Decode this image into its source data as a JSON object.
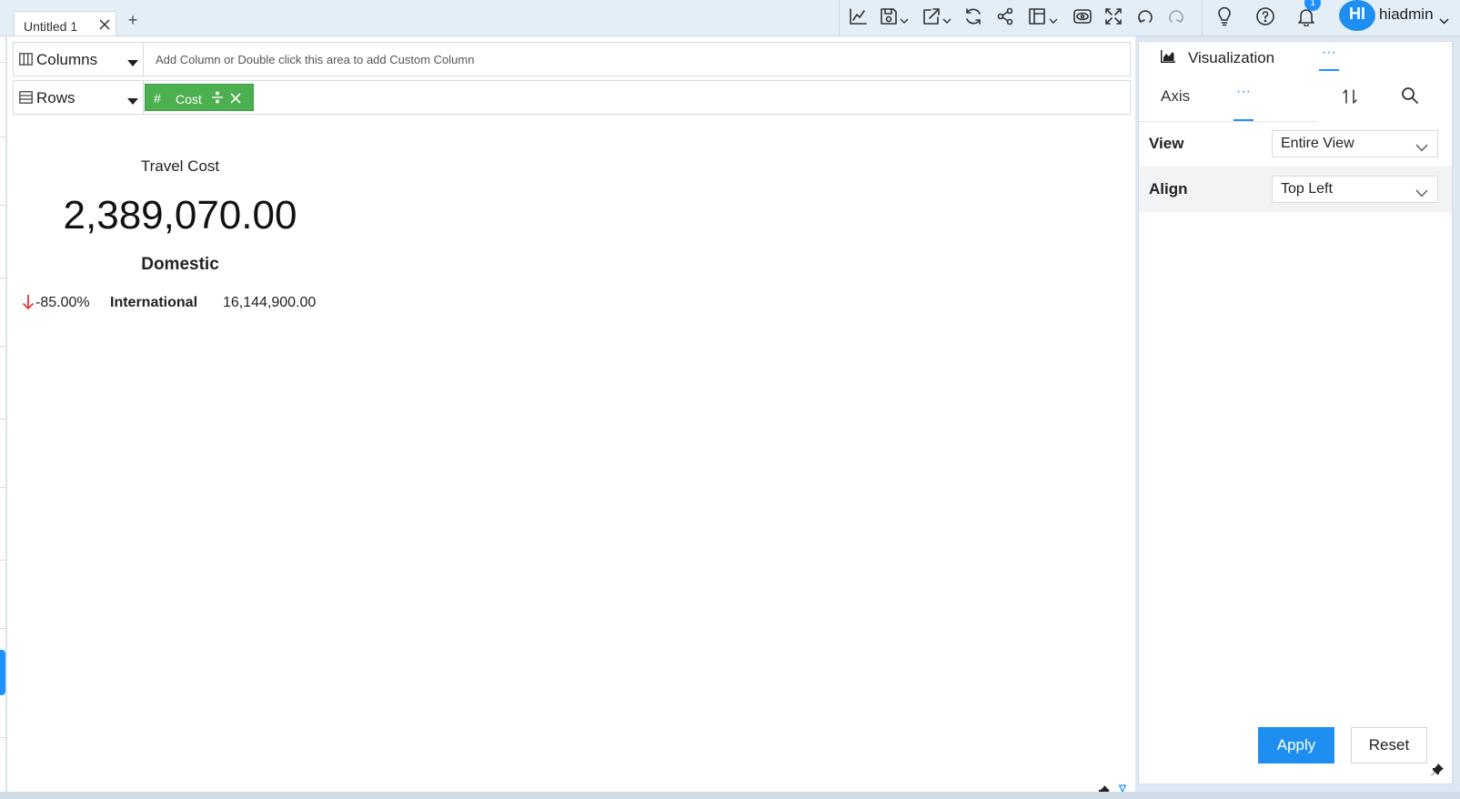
{
  "tabs": [
    {
      "label": "Untitled 1"
    }
  ],
  "toolbar": {
    "icons": [
      "line-chart-icon",
      "save-icon",
      "export-icon",
      "refresh-icon",
      "share-icon",
      "layout-icon",
      "preview-icon",
      "fullscreen-icon",
      "undo-icon",
      "redo-icon",
      "bulb-icon",
      "help-icon",
      "bell-icon"
    ],
    "notification_count": "1"
  },
  "user": {
    "initials": "HI",
    "name": "hiadmin"
  },
  "shelves": {
    "columns": {
      "label": "Columns",
      "placeholder": "Add Column or Double click this area to add Custom Column"
    },
    "rows": {
      "label": "Rows",
      "pill": {
        "hash": "#",
        "label": "Cost",
        "color": "#4caf50"
      }
    }
  },
  "kpi": {
    "title": "Travel Cost",
    "value": "2,389,070.00",
    "subtitle": "Domestic",
    "comparison": {
      "percent": "-85.00%",
      "label": "International",
      "value": "16,144,900.00",
      "trend_color": "#e53935"
    }
  },
  "panel": {
    "tab_label": "Visualization",
    "more_label": "···",
    "subtab_label": "Axis",
    "subtab_more_label": "···",
    "view": {
      "label": "View",
      "value": "Entire View"
    },
    "align": {
      "label": "Align",
      "value": "Top Left"
    },
    "apply_label": "Apply",
    "reset_label": "Reset"
  },
  "colors": {
    "accent": "#1e8ff0",
    "pill": "#4caf50",
    "down": "#e53935"
  }
}
